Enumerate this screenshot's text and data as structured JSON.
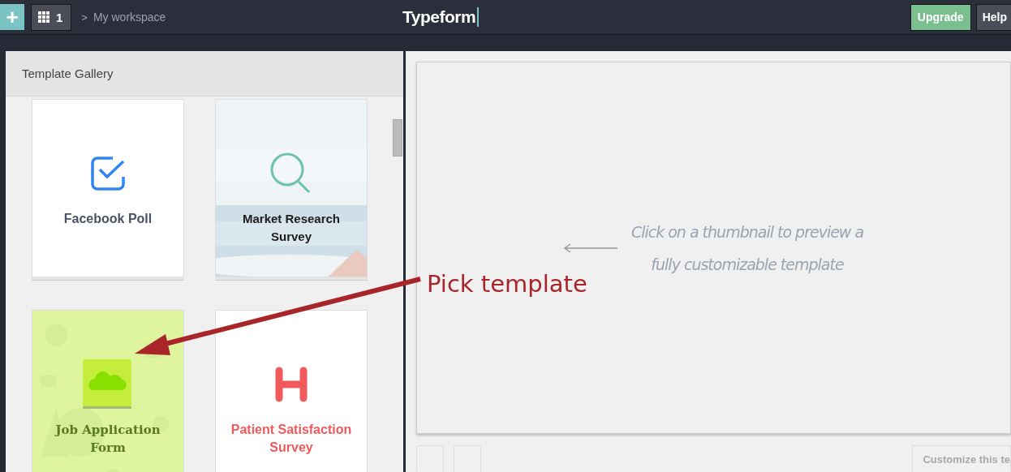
{
  "topbar": {
    "add_button": "+",
    "apps_count": "1",
    "breadcrumb_separator": ">",
    "breadcrumb": "My workspace",
    "logo": "Typeform",
    "upgrade_button": "Upgrade",
    "help_button": "Help"
  },
  "gallery": {
    "title": "Template Gallery",
    "templates": [
      {
        "title": "Facebook Poll",
        "kind": "check",
        "color": "#4a5163"
      },
      {
        "title": "Market Research Survey",
        "kind": "search",
        "color": "#1c1c1c"
      },
      {
        "title": "Job Application Form",
        "kind": "cloud",
        "color": "#5b7a1e"
      },
      {
        "title": "Patient Satisfaction Survey",
        "kind": "hospital",
        "color": "#ef5a5c"
      }
    ]
  },
  "preview": {
    "hint": "Click on a thumbnail to preview a fully customizable template",
    "customize_button": "Customize this te"
  },
  "annotation": {
    "text": "Pick template"
  }
}
